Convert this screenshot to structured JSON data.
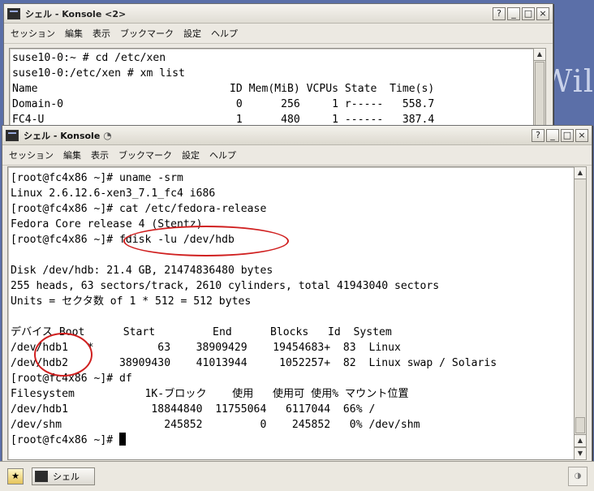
{
  "desktop": {
    "bg_text": "Wil"
  },
  "back_window": {
    "title": "シェル - Konsole <2>",
    "menu": [
      "セッション",
      "編集",
      "表示",
      "ブックマーク",
      "設定",
      "ヘルプ"
    ],
    "lines": [
      "suse10-0:~ # cd /etc/xen",
      "suse10-0:/etc/xen # xm list",
      "Name                              ID Mem(MiB) VCPUs State  Time(s)",
      "Domain-0                           0      256     1 r-----   558.7",
      "FC4-U                              1      480     1 ------   387.4"
    ]
  },
  "front_window": {
    "title": "シェル - Konsole",
    "title_extra": "◔",
    "menu": [
      "セッション",
      "編集",
      "表示",
      "ブックマーク",
      "設定",
      "ヘルプ"
    ],
    "lines": [
      "[root@fc4x86 ~]# uname -srm",
      "Linux 2.6.12.6-xen3_7.1_fc4 i686",
      "[root@fc4x86 ~]# cat /etc/fedora-release",
      "Fedora Core release 4 (Stentz)",
      "[root@fc4x86 ~]# fdisk -lu /dev/hdb",
      "",
      "Disk /dev/hdb: 21.4 GB, 21474836480 bytes",
      "255 heads, 63 sectors/track, 2610 cylinders, total 41943040 sectors",
      "Units = セクタ数 of 1 * 512 = 512 bytes",
      "",
      "デバイス Boot      Start         End      Blocks   Id  System",
      "/dev/hdb1   *          63    38909429    19454683+  83  Linux",
      "/dev/hdb2        38909430    41013944     1052257+  82  Linux swap / Solaris",
      "[root@fc4x86 ~]# df",
      "Filesystem           1K-ブロック    使用   使用可 使用% マウント位置",
      "/dev/hdb1             18844840  11755064   6117044  66% /",
      "/dev/shm                245852         0    245852   0% /dev/shm"
    ],
    "prompt": "[root@fc4x86 ~]# "
  },
  "taskbar": {
    "task_label": "シェル"
  },
  "annotation_color": "#d02020"
}
